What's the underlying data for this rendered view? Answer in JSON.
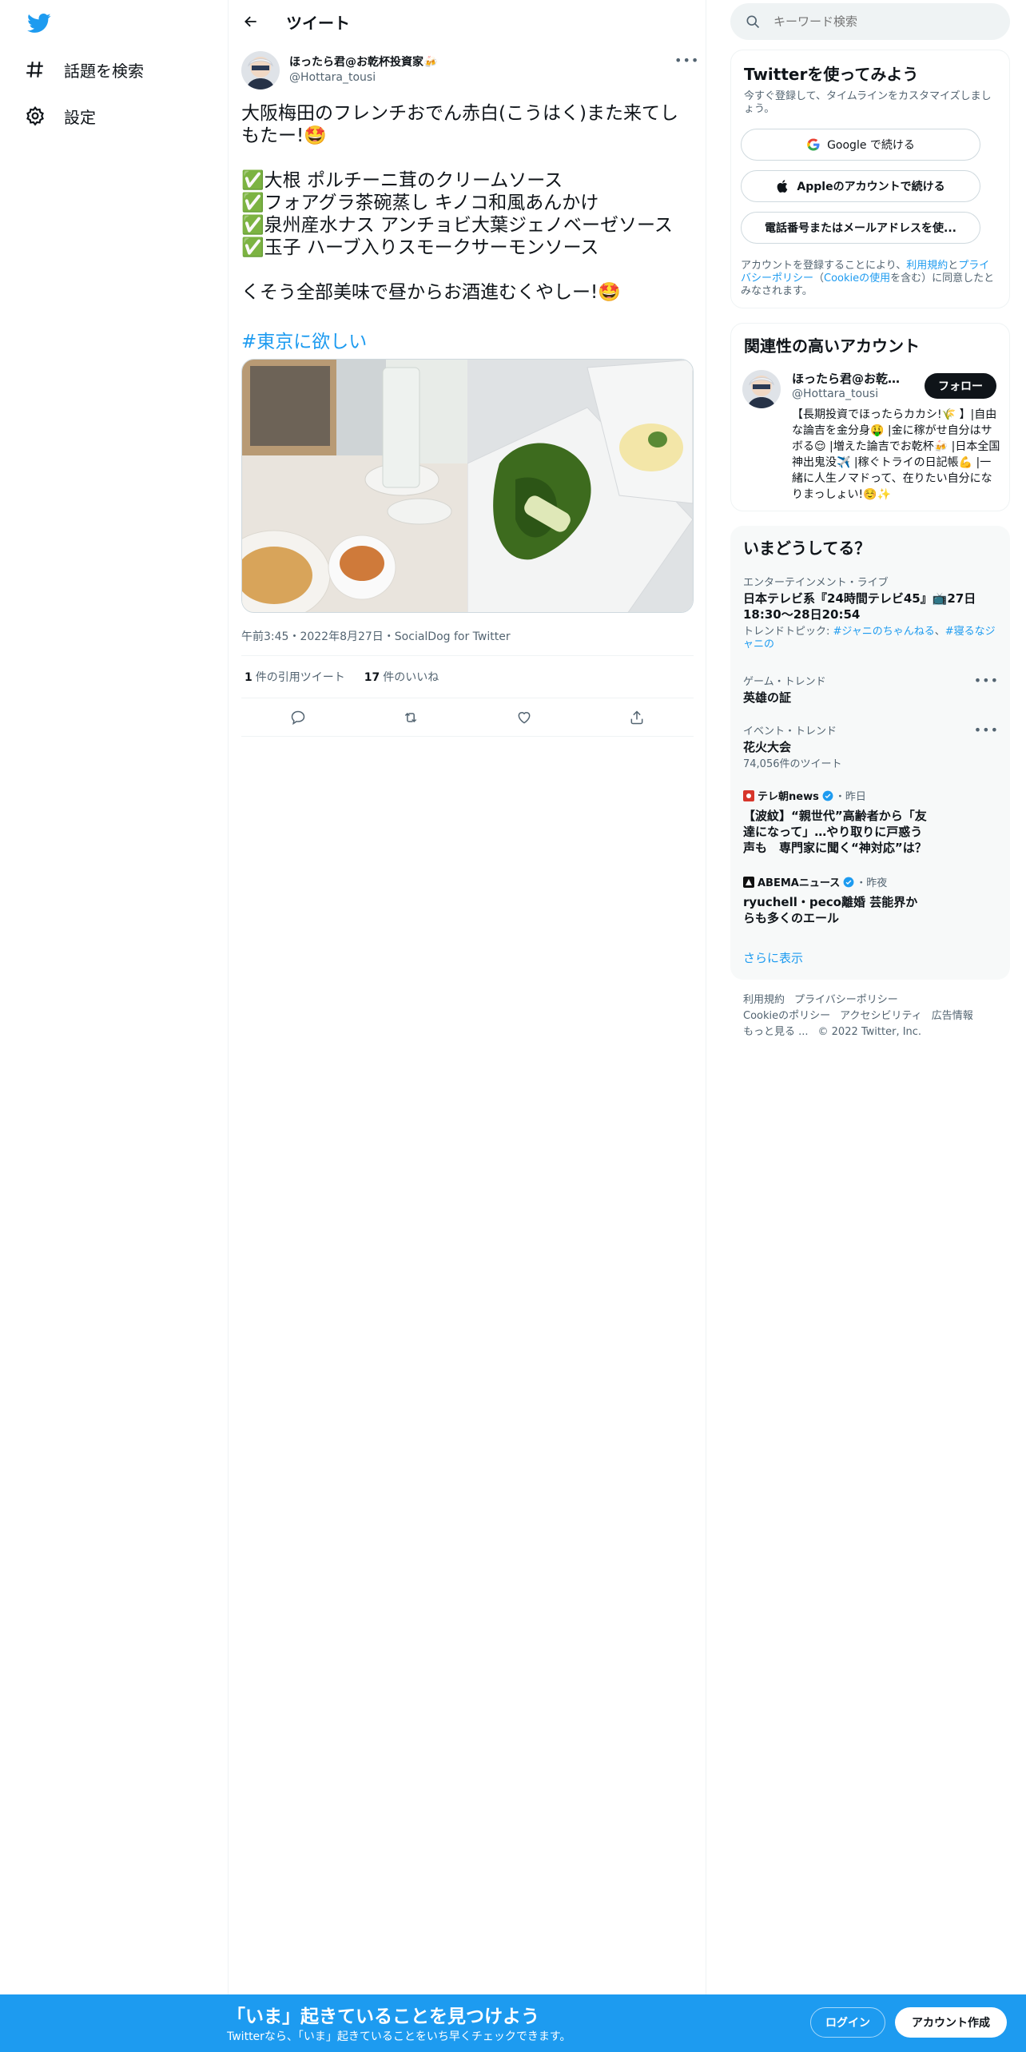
{
  "nav": {
    "logo": "twitter-bird-icon",
    "explore_label": "話題を検索",
    "settings_label": "設定"
  },
  "header": {
    "title": "ツイート"
  },
  "tweet": {
    "author_name": "ほったら君@お乾杯投資家🍻",
    "author_handle": "@Hottara_tousi",
    "text": "大阪梅田のフレンチおでん赤白(こうはく)また来てしもたー!🤩\n\n✅大根 ポルチーニ茸のクリームソース\n✅フォアグラ茶碗蒸し キノコ和風あんかけ\n✅泉州産水ナス アンチョビ大葉ジェノベーゼソース\n✅玉子 ハーブ入りスモークサーモンソース\n\nくそう全部美味で昼からお酒進むくやしー!🤩",
    "hashtag": "#東京に欲しい",
    "meta": "午前3:45・2022年8月27日・SocialDog for Twitter",
    "quote_count": "1",
    "quote_label": "件の引用ツイート",
    "like_count": "17",
    "like_label": "件のいいね"
  },
  "search": {
    "placeholder": "キーワード検索"
  },
  "signup_panel": {
    "title": "Twitterを使ってみよう",
    "note": "今すぐ登録して、タイムラインをカスタマイズしましょう。",
    "google_label": "Google で続ける",
    "apple_label": "Appleのアカウントで続ける",
    "phone_label": "電話番号またはメールアドレスを使...",
    "legal_pre": "アカウントを登録することにより、",
    "legal_terms": "利用規約",
    "legal_and": "と",
    "legal_privacy": "プライバシーポリシー",
    "legal_cookie_pre": "（",
    "legal_cookie": "Cookieの使用",
    "legal_post": "を含む）に同意したとみなされます。"
  },
  "relevant_panel": {
    "title": "関連性の高いアカウント",
    "name": "ほったら君@お乾杯...",
    "handle": "@Hottara_tousi",
    "follow_label": "フォロー",
    "bio": "【長期投資でほったらカカシ!🌾 】|自由な論吉を金分身🤑 |金に稼がせ自分はサボる😌 |増えた論吉でお乾杯🍻 |日本全国神出鬼没✈️ |稼ぐトライの日記帳💪 |一緒に人生ノマドって、在りたい自分になりまっしょい!☺️✨"
  },
  "trends_panel": {
    "title": "いまどうしてる？",
    "items": [
      {
        "context": "エンターテインメント・ライブ",
        "name": "日本テレビ系『24時間テレビ45』📺27日18:30〜28日20:54",
        "sub_pre": "トレンドトピック: ",
        "sub_link1": "#ジャニのちゃんねる",
        "sub_sep": "、",
        "sub_link2": "#寝るなジャニの"
      },
      {
        "context": "ゲーム・トレンド",
        "name": "英雄の証"
      },
      {
        "context": "イベント・トレンド",
        "name": "花火大会",
        "count": "74,056件のツイート"
      },
      {
        "source": "テレ朝news",
        "time": "・昨日",
        "name": "【波紋】“親世代”高齢者から「友達になって」…やり取りに戸惑う声も　専門家に聞く“神対応”は？"
      },
      {
        "source": "ABEMAニュース",
        "time": "・昨夜",
        "name": "ryuchell・peco離婚 芸能界からも多くのエール"
      }
    ],
    "show_more": "さらに表示"
  },
  "footer": {
    "terms": "利用規約",
    "privacy": "プライバシーポリシー",
    "cookie": "Cookieのポリシー",
    "accessibility": "アクセシビリティ",
    "ads": "広告情報",
    "more": "もっと見る ...",
    "copyright": "© 2022 Twitter, Inc."
  },
  "banner": {
    "title": "「いま」起きていることを見つけよう",
    "subtitle": "Twitterなら、「いま」起きていることをいち早くチェックできます。",
    "login_label": "ログイン",
    "signup_label": "アカウント作成"
  },
  "colors": {
    "accent": "#1d9bf0",
    "text": "#0f1419",
    "muted": "#536471"
  }
}
